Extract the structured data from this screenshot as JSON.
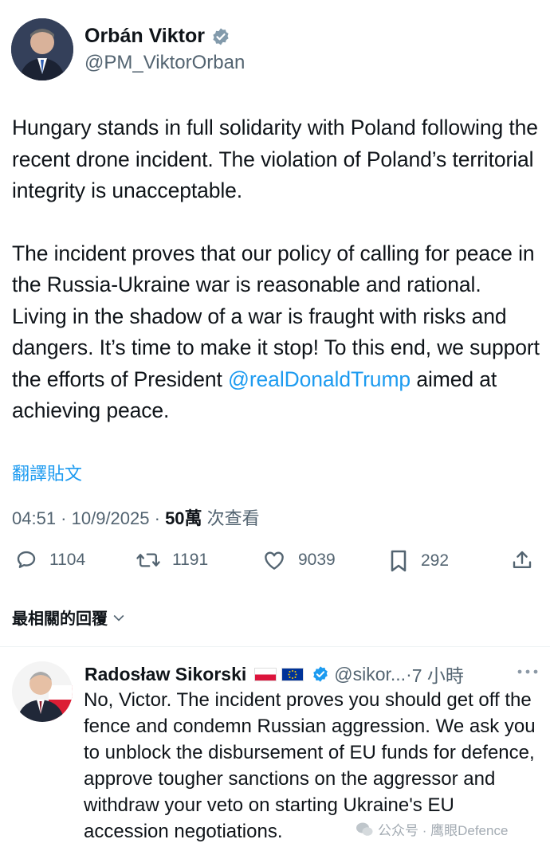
{
  "tweet": {
    "author_name": "Orbán Viktor",
    "author_handle": "@PM_ViktorOrban",
    "paragraph1": "Hungary stands in full solidarity with Poland following the recent drone incident. The violation of Poland’s territorial integrity is unacceptable.",
    "paragraph2_before": "The incident proves that our policy of calling for peace in the Russia-Ukraine war is reasonable and rational. Living in the shadow of a war is fraught with risks and dangers. It’s time to make it stop! To this end, we support the efforts of President ",
    "mention": "@realDonaldTrump",
    "paragraph2_after": " aimed at achieving peace.",
    "translate_label": "翻譯貼文",
    "time": "04:51",
    "date": "10/9/2025",
    "views_count": "50萬",
    "views_label": "次查看",
    "replies": "1104",
    "reposts": "1191",
    "likes": "9039",
    "bookmarks": "292"
  },
  "sort": {
    "label": "最相關的回覆"
  },
  "reply": {
    "author_name": "Radosław Sikorski",
    "author_handle": "@sikor...",
    "time_ago": "7 小時",
    "text": "No, Victor.  The incident proves you should get off the fence and condemn Russian aggression. We ask you to unblock the disbursement of EU funds for defence, approve tougher sanctions on the aggressor and withdraw your veto on starting Ukraine's EU accession negotiations."
  },
  "watermark": {
    "text": "公众号 · 鹰眼Defence"
  },
  "colors": {
    "link": "#1d9bf0",
    "verified_gray": "#829aab",
    "verified_blue": "#1d9bf0",
    "muted": "#536471"
  }
}
